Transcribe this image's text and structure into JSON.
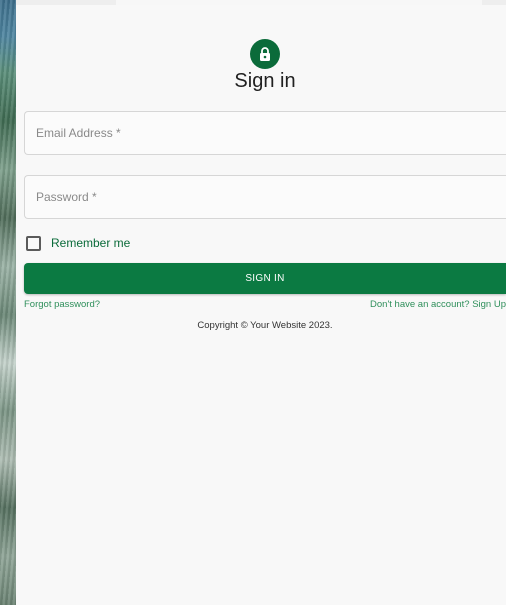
{
  "form": {
    "title": "Sign in",
    "email_placeholder": "Email Address *",
    "password_placeholder": "Password *",
    "remember_label": "Remember me",
    "submit_label": "SIGN IN",
    "forgot_link": "Forgot password?",
    "signup_link": "Don't have an account? Sign Up",
    "copyright": "Copyright © Your Website 2023."
  },
  "icons": {
    "avatar": "lock-icon"
  },
  "colors": {
    "primary": "#0b7a42",
    "avatar": "#0b6b3a",
    "link": "#2f8f5b"
  }
}
